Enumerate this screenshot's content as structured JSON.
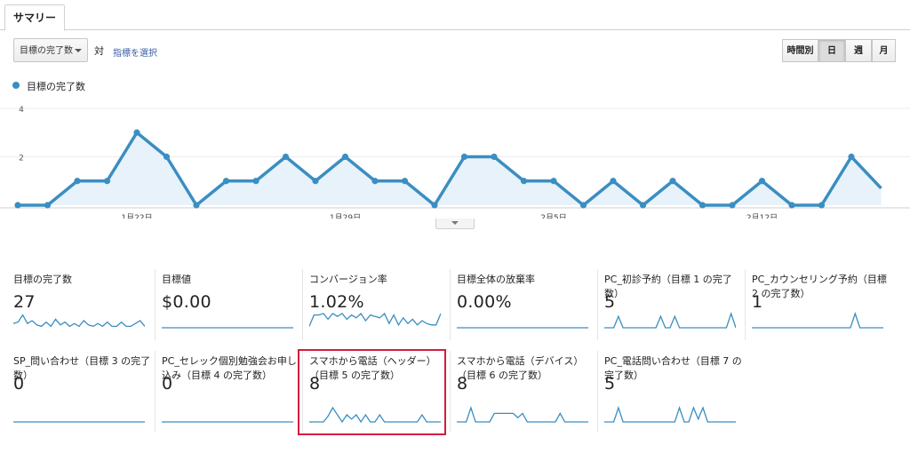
{
  "tabs": [
    {
      "label": "サマリー",
      "active": true
    }
  ],
  "controls": {
    "metric_select": "目標の完了数",
    "vs_label": "対",
    "select_metric_link": "指標を選択",
    "granularity": [
      {
        "label": "時間別",
        "active": false
      },
      {
        "label": "日",
        "active": true
      },
      {
        "label": "週",
        "active": false
      },
      {
        "label": "月",
        "active": false
      }
    ]
  },
  "colors": {
    "series": "#3a8ec2",
    "area": "#e8f2fa",
    "highlight": "#d01f3c"
  },
  "chart_data": {
    "type": "line",
    "legend": "目標の完了数",
    "series": [
      {
        "name": "目標の完了数",
        "values": [
          0,
          0,
          1,
          1,
          3,
          2,
          0,
          1,
          1,
          2,
          1,
          2,
          1,
          1,
          0,
          2,
          2,
          1,
          1,
          0,
          1,
          0,
          1,
          0,
          0,
          1,
          0,
          0,
          2,
          0.7
        ]
      }
    ],
    "y_ticks": [
      "4",
      "2"
    ],
    "ylim": [
      0,
      4
    ],
    "x_ticks": [
      {
        "index": 4,
        "label": "1月22日"
      },
      {
        "index": 11,
        "label": "1月29日"
      },
      {
        "index": 18,
        "label": "2月5日"
      },
      {
        "index": 25,
        "label": "2月12日"
      }
    ],
    "grid": true,
    "area_fill": true
  },
  "scorecards": [
    {
      "title": "目標の完了数",
      "value": "27",
      "spark": [
        0.3,
        0.4,
        0.9,
        0.3,
        0.5,
        0.2,
        0.1,
        0.4,
        0.1,
        0.6,
        0.2,
        0.4,
        0.1,
        0.3,
        0.1,
        0.5,
        0.2,
        0.1,
        0.3,
        0.1,
        0.4,
        0.1,
        0.1,
        0.4,
        0.1,
        0.1,
        0.3,
        0.5,
        0.1
      ]
    },
    {
      "title": "目標値",
      "value": "$0.00",
      "spark": [
        0,
        0,
        0,
        0,
        0,
        0,
        0,
        0,
        0,
        0,
        0,
        0,
        0,
        0,
        0,
        0,
        0,
        0,
        0,
        0,
        0,
        0,
        0,
        0,
        0,
        0,
        0,
        0,
        0
      ]
    },
    {
      "title": "コンバージョン率",
      "value": "1.02%",
      "spark": [
        0.1,
        0.9,
        0.9,
        1.0,
        0.6,
        1.0,
        0.8,
        1.0,
        0.6,
        0.9,
        0.7,
        1.0,
        0.5,
        0.9,
        0.8,
        0.7,
        1.0,
        0.3,
        0.9,
        0.2,
        0.7,
        0.3,
        0.6,
        0.2,
        0.5,
        0.3,
        0.2,
        0.2,
        1.0
      ]
    },
    {
      "title": "目標全体の放棄率",
      "value": "0.00%",
      "spark": [
        0,
        0,
        0,
        0,
        0,
        0,
        0,
        0,
        0,
        0,
        0,
        0,
        0,
        0,
        0,
        0,
        0,
        0,
        0,
        0,
        0,
        0,
        0,
        0,
        0,
        0,
        0,
        0,
        0
      ]
    },
    {
      "title": "PC_初診予約（目標 1 の完了数）",
      "value": "5",
      "spark": [
        0,
        0,
        0,
        0.8,
        0,
        0,
        0,
        0,
        0,
        0,
        0,
        0,
        0.8,
        0,
        0,
        0.8,
        0,
        0,
        0,
        0,
        0,
        0,
        0,
        0,
        0,
        0,
        0,
        1.0,
        0
      ]
    },
    {
      "title": "PC_カウンセリング予約（目標 2 の完了数）",
      "value": "1",
      "spark": [
        0,
        0,
        0,
        0,
        0,
        0,
        0,
        0,
        0,
        0,
        0,
        0,
        0,
        0,
        0,
        0,
        0,
        0,
        0,
        0,
        0,
        0,
        1.0,
        0,
        0,
        0,
        0,
        0,
        0
      ]
    },
    {
      "title": "SP_問い合わせ（目標 3 の完了数）",
      "value": "0",
      "spark": [
        0,
        0,
        0,
        0,
        0,
        0,
        0,
        0,
        0,
        0,
        0,
        0,
        0,
        0,
        0,
        0,
        0,
        0,
        0,
        0,
        0,
        0,
        0,
        0,
        0,
        0,
        0,
        0,
        0
      ]
    },
    {
      "title": "PC_セレック個別勉強会お申し込み（目標 4 の完了数）",
      "value": "0",
      "spark": [
        0,
        0,
        0,
        0,
        0,
        0,
        0,
        0,
        0,
        0,
        0,
        0,
        0,
        0,
        0,
        0,
        0,
        0,
        0,
        0,
        0,
        0,
        0,
        0,
        0,
        0,
        0,
        0,
        0
      ]
    },
    {
      "title": "スマホから電話（ヘッダー）（目標 5 の完了数）",
      "value": "8",
      "spark": [
        0,
        0,
        0,
        0,
        0.4,
        1.0,
        0.5,
        0,
        0.5,
        0.2,
        0.5,
        0,
        0.5,
        0,
        0,
        0.5,
        0,
        0,
        0,
        0,
        0,
        0,
        0,
        0,
        0.5,
        0,
        0,
        0,
        0
      ]
    },
    {
      "title": "スマホから電話（デバイス）（目標 6 の完了数）",
      "value": "8",
      "spark": [
        0,
        0,
        0,
        1.0,
        0,
        0,
        0,
        0,
        0.6,
        0.6,
        0.6,
        0.6,
        0.6,
        0.3,
        0.6,
        0,
        0,
        0,
        0,
        0,
        0,
        0,
        0.6,
        0,
        0,
        0,
        0,
        0,
        0
      ]
    },
    {
      "title": "PC_電話問い合わせ（目標 7 の完了数）",
      "value": "5",
      "spark": [
        0,
        0,
        0,
        1.0,
        0,
        0,
        0,
        0,
        0,
        0,
        0,
        0,
        0,
        0,
        0,
        0,
        1.0,
        0,
        0,
        1.0,
        0.2,
        1.0,
        0,
        0,
        0,
        0,
        0,
        0,
        0
      ]
    }
  ]
}
